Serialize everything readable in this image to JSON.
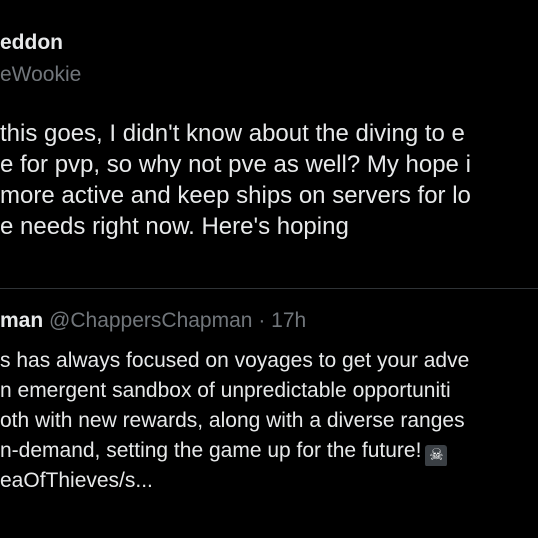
{
  "tweet": {
    "author_name": "eddon",
    "author_handle": "eWookie",
    "body_lines": [
      "this goes, I didn't know about the diving to e",
      "e for pvp, so why not pve as well? My hope i",
      " more active and keep ships on servers for lo",
      "e needs right now. Here's hoping"
    ]
  },
  "quote": {
    "author_name": "man",
    "author_handle": "@ChappersChapman",
    "separator": "·",
    "timestamp": "17h",
    "body_lines": [
      "s has always focused on voyages to get your adve",
      "n emergent sandbox of unpredictable opportuniti",
      "oth with new rewards, along with a diverse ranges",
      "n-demand, setting the game up for the future!",
      "eaOfThieves/s..."
    ],
    "emoji_icon": "skull-crossbones-icon",
    "emoji_glyph": "☠"
  }
}
